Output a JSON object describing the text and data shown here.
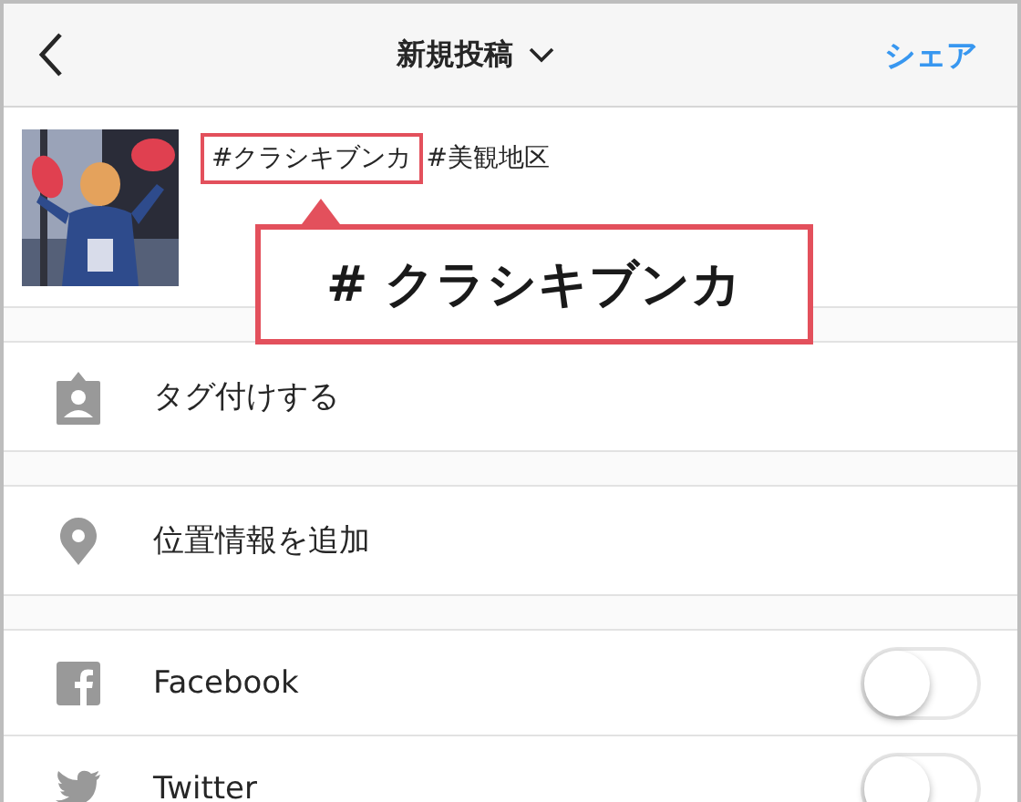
{
  "header": {
    "title": "新規投稿",
    "share": "シェア"
  },
  "caption": {
    "hashtags": [
      {
        "text": "#クラシキブンカ",
        "highlighted": true
      },
      {
        "text": "#美観地区",
        "highlighted": false
      }
    ]
  },
  "callout": {
    "text": "# クラシキブンカ"
  },
  "options": [
    {
      "label": "タグ付けする"
    },
    {
      "label": "位置情報を追加"
    }
  ],
  "share_targets": [
    {
      "label": "Facebook",
      "on": false
    },
    {
      "label": "Twitter",
      "on": false
    }
  ]
}
